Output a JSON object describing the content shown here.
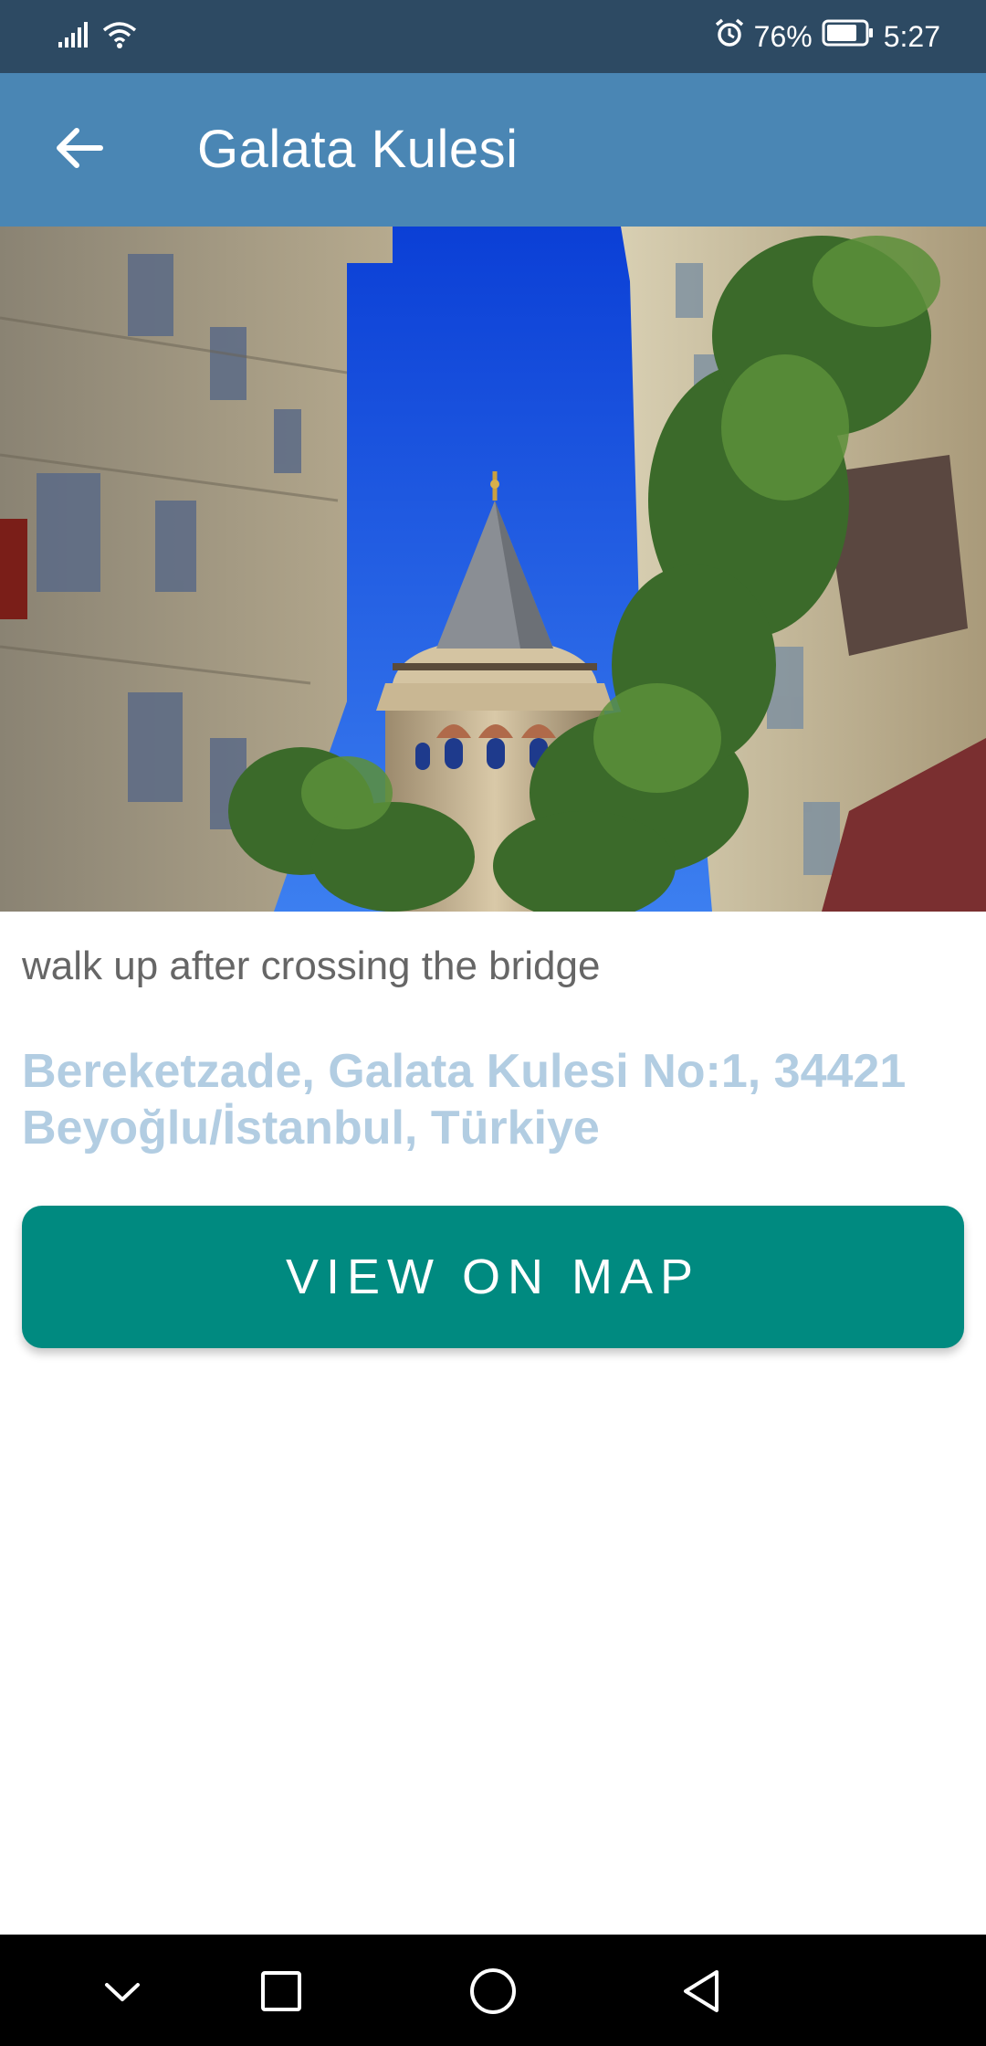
{
  "status_bar": {
    "battery_percent": "76%",
    "time": "5:27",
    "icons": [
      "signal-icon",
      "wifi-icon",
      "alarm-icon",
      "battery-icon"
    ]
  },
  "app_bar": {
    "title": "Galata Kulesi",
    "back_icon": "arrow-left-icon"
  },
  "hero_image": {
    "subject": "galata-tower-photo"
  },
  "place": {
    "description": "walk up after crossing the bridge",
    "address": "Bereketzade, Galata Kulesi No:1, 34421 Beyoğlu/İstanbul, Türkiye"
  },
  "actions": {
    "view_on_map_label": "VIEW ON MAP"
  },
  "nav_bar": {
    "icons": [
      "chevron-down-icon",
      "square-icon",
      "circle-icon",
      "triangle-back-icon"
    ]
  },
  "colors": {
    "status_bar": "#2d4a63",
    "app_bar": "#4a86b4",
    "address_text": "#b2cde2",
    "button": "#008a80"
  }
}
